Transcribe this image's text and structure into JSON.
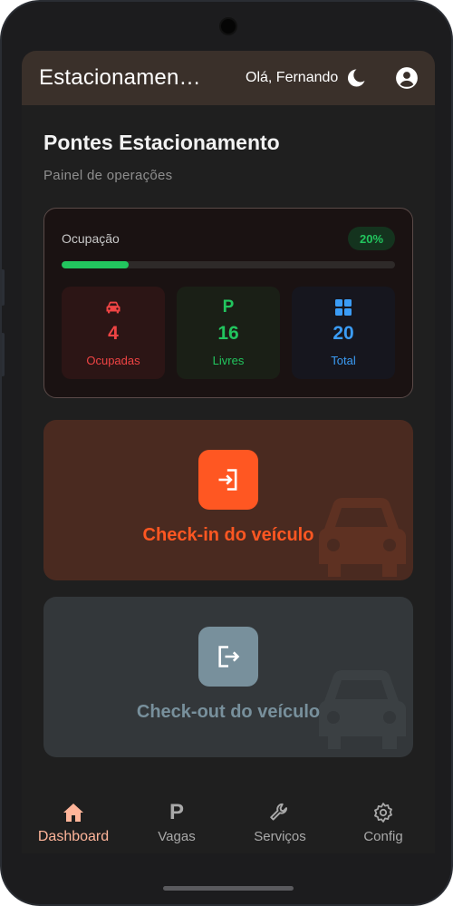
{
  "appbar": {
    "title": "Estacionamen…",
    "greeting": "Olá, Fernando",
    "theme_icon": "moon-icon",
    "profile_icon": "account-circle-icon"
  },
  "header": {
    "title": "Pontes Estacionamento",
    "subtitle": "Painel de operações"
  },
  "occupancy": {
    "label": "Ocupação",
    "percent_label": "20%",
    "percent_value": 20,
    "stats": [
      {
        "icon": "car-icon",
        "value": "4",
        "label": "Ocupadas",
        "color": "#ef4444"
      },
      {
        "icon": "parking-icon",
        "value": "16",
        "label": "Livres",
        "color": "#22c55e"
      },
      {
        "icon": "grid-icon",
        "value": "20",
        "label": "Total",
        "color": "#3b9cf5"
      }
    ]
  },
  "actions": {
    "checkin_label": "Check-in do veículo",
    "checkout_label": "Check-out do veículo",
    "checkin_color": "#ff5722",
    "checkout_color": "#78909c"
  },
  "nav": {
    "items": [
      {
        "label": "Dashboard",
        "icon": "home-icon",
        "active": true
      },
      {
        "label": "Vagas",
        "icon": "parking-icon",
        "active": false
      },
      {
        "label": "Serviços",
        "icon": "wrench-icon",
        "active": false
      },
      {
        "label": "Config",
        "icon": "gear-icon",
        "active": false
      }
    ]
  }
}
